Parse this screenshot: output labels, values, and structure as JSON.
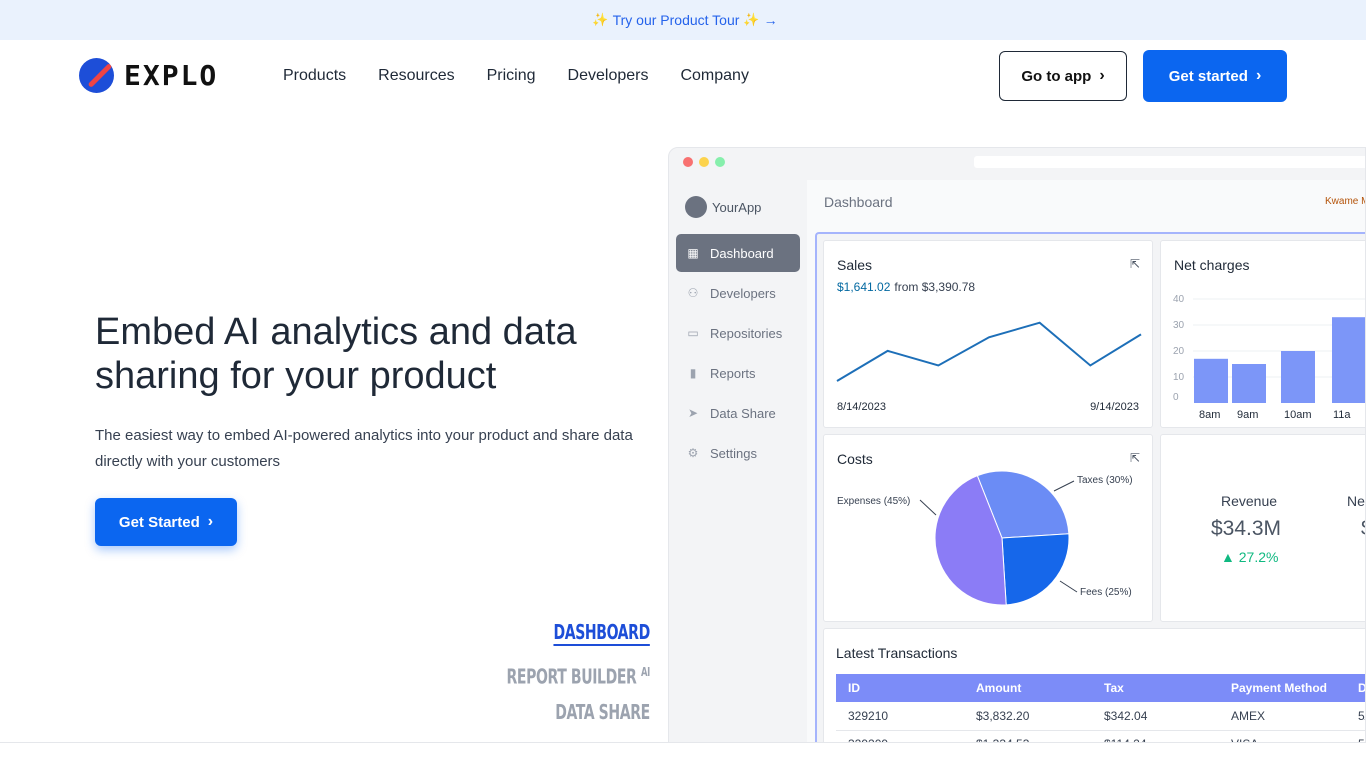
{
  "banner": {
    "text": "Try our Product Tour",
    "spark_left": "✨",
    "spark_right": "✨",
    "arrow": "→"
  },
  "nav": {
    "brand": "EXPLO",
    "items": [
      "Products",
      "Resources",
      "Pricing",
      "Developers",
      "Company"
    ],
    "go_to_app": "Go to app",
    "get_started": "Get started",
    "chevron": "›"
  },
  "hero": {
    "title": "Embed AI analytics and data sharing for your product",
    "subtitle": "The easiest way to embed AI-powered analytics into your product and share data directly with your customers",
    "cta": "Get Started",
    "chevron": "›"
  },
  "modes": {
    "items": [
      "DASHBOARD",
      "REPORT BUILDER",
      "DATA SHARE"
    ],
    "ai_badge": "AI",
    "active": "DASHBOARD"
  },
  "preview": {
    "app_name": "YourApp",
    "sidebar": [
      {
        "label": "Dashboard",
        "icon": "grid-icon",
        "active": true
      },
      {
        "label": "Developers",
        "icon": "users-icon",
        "active": false
      },
      {
        "label": "Repositories",
        "icon": "folder-icon",
        "active": false
      },
      {
        "label": "Reports",
        "icon": "bar-chart-icon",
        "active": false
      },
      {
        "label": "Data Share",
        "icon": "send-icon",
        "active": false
      },
      {
        "label": "Settings",
        "icon": "gear-icon",
        "active": false
      }
    ],
    "page_title": "Dashboard",
    "user": "Kwame M",
    "sales": {
      "title": "Sales",
      "value": "$1,641.02",
      "from": "from $3,390.78",
      "start": "8/14/2023",
      "end": "9/14/2023"
    },
    "net_charges": {
      "title": "Net charges",
      "y_ticks": [
        "40",
        "30",
        "20",
        "10",
        "0"
      ],
      "x_labels": [
        "8am",
        "9am",
        "10am",
        "11a"
      ]
    },
    "costs": {
      "title": "Costs",
      "slices": [
        {
          "label": "Expenses (45%)",
          "value": 45,
          "color": "#8b7cf6"
        },
        {
          "label": "Taxes (30%)",
          "value": 30,
          "color": "#6b8cf5"
        },
        {
          "label": "Fees (25%)",
          "value": 25,
          "color": "#1667ea"
        }
      ]
    },
    "kpi": {
      "label": "Revenue",
      "value": "$34.3M",
      "delta": "▲ 27.2%",
      "label2": "Ne",
      "value2": "$"
    },
    "transactions": {
      "title": "Latest Transactions",
      "columns": [
        "ID",
        "Amount",
        "Tax",
        "Payment Method",
        "D"
      ],
      "rows": [
        [
          "329210",
          "$3,832.20",
          "$342.04",
          "AMEX",
          "5/"
        ],
        [
          "329209",
          "$1,334.53",
          "$114.24",
          "VISA",
          "5/"
        ]
      ]
    }
  },
  "chart_data": [
    {
      "type": "line",
      "title": "Sales",
      "x": [
        "8/14/2023",
        "",
        "",
        "",
        "",
        "",
        "9/14/2023"
      ],
      "series": [
        {
          "values": [
            0,
            31,
            16,
            45,
            60,
            16,
            48
          ]
        }
      ],
      "ylim": [
        0,
        70
      ]
    },
    {
      "type": "bar",
      "title": "Net charges",
      "categories": [
        "8am",
        "9am",
        "10am",
        "11a"
      ],
      "values": [
        17,
        15,
        20,
        33
      ],
      "ylim": [
        0,
        40
      ]
    },
    {
      "type": "pie",
      "title": "Costs",
      "categories": [
        "Expenses (45%)",
        "Taxes (30%)",
        "Fees (25%)"
      ],
      "values": [
        45,
        30,
        25
      ]
    }
  ]
}
